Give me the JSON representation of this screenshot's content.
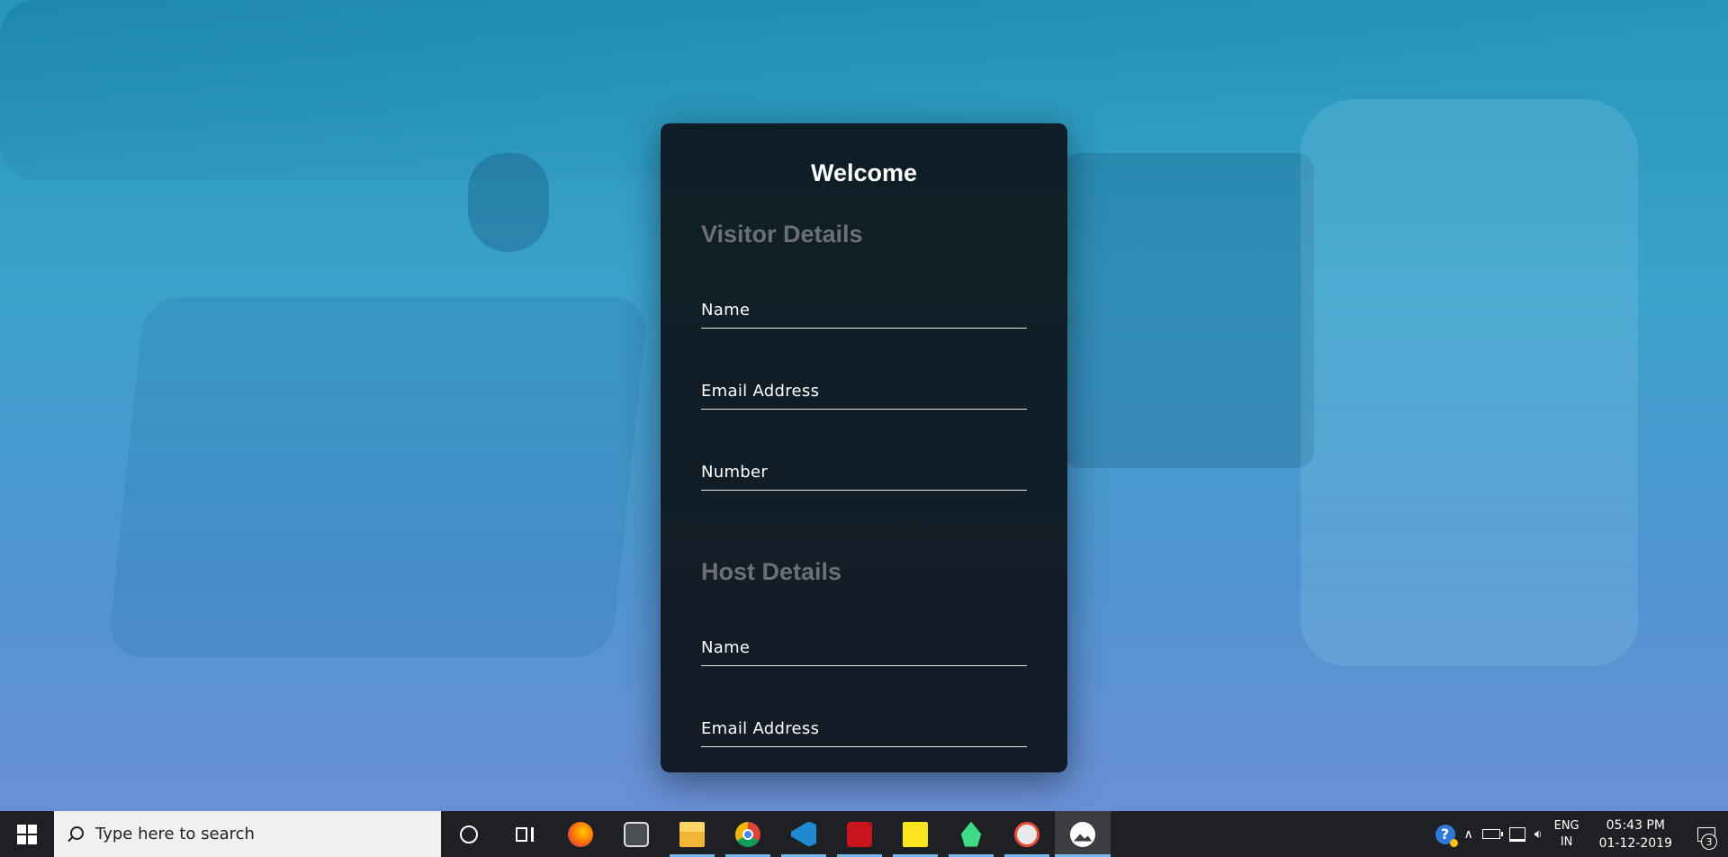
{
  "form": {
    "title": "Welcome",
    "visitor_heading": "Visitor Details",
    "visitor_fields": [
      "Name",
      "Email Address",
      "Number"
    ],
    "host_heading": "Host Details",
    "host_fields": [
      "Name",
      "Email Address"
    ]
  },
  "taskbar": {
    "search_placeholder": "Type here to search",
    "apps": [
      {
        "name": "firefox-icon",
        "running": false
      },
      {
        "name": "settings-app-icon",
        "running": false
      },
      {
        "name": "file-explorer-icon",
        "running": true
      },
      {
        "name": "chrome-icon",
        "running": true
      },
      {
        "name": "vscode-icon",
        "running": true
      },
      {
        "name": "acrobat-icon",
        "running": true
      },
      {
        "name": "sticky-notes-icon",
        "running": true
      },
      {
        "name": "android-studio-icon",
        "running": true
      },
      {
        "name": "snipping-tool-icon",
        "running": true
      },
      {
        "name": "photos-icon",
        "running": true
      }
    ],
    "tray": {
      "language_top": "ENG",
      "language_bottom": "IN",
      "time": "05:43 PM",
      "date": "01-12-2019",
      "notification_count": "3"
    }
  },
  "colors": {
    "card_bg": "#0f1e26",
    "heading_gray": "#6c6f74",
    "taskbar_bg": "#1f2023",
    "accent_underline": "#76b9ed"
  }
}
